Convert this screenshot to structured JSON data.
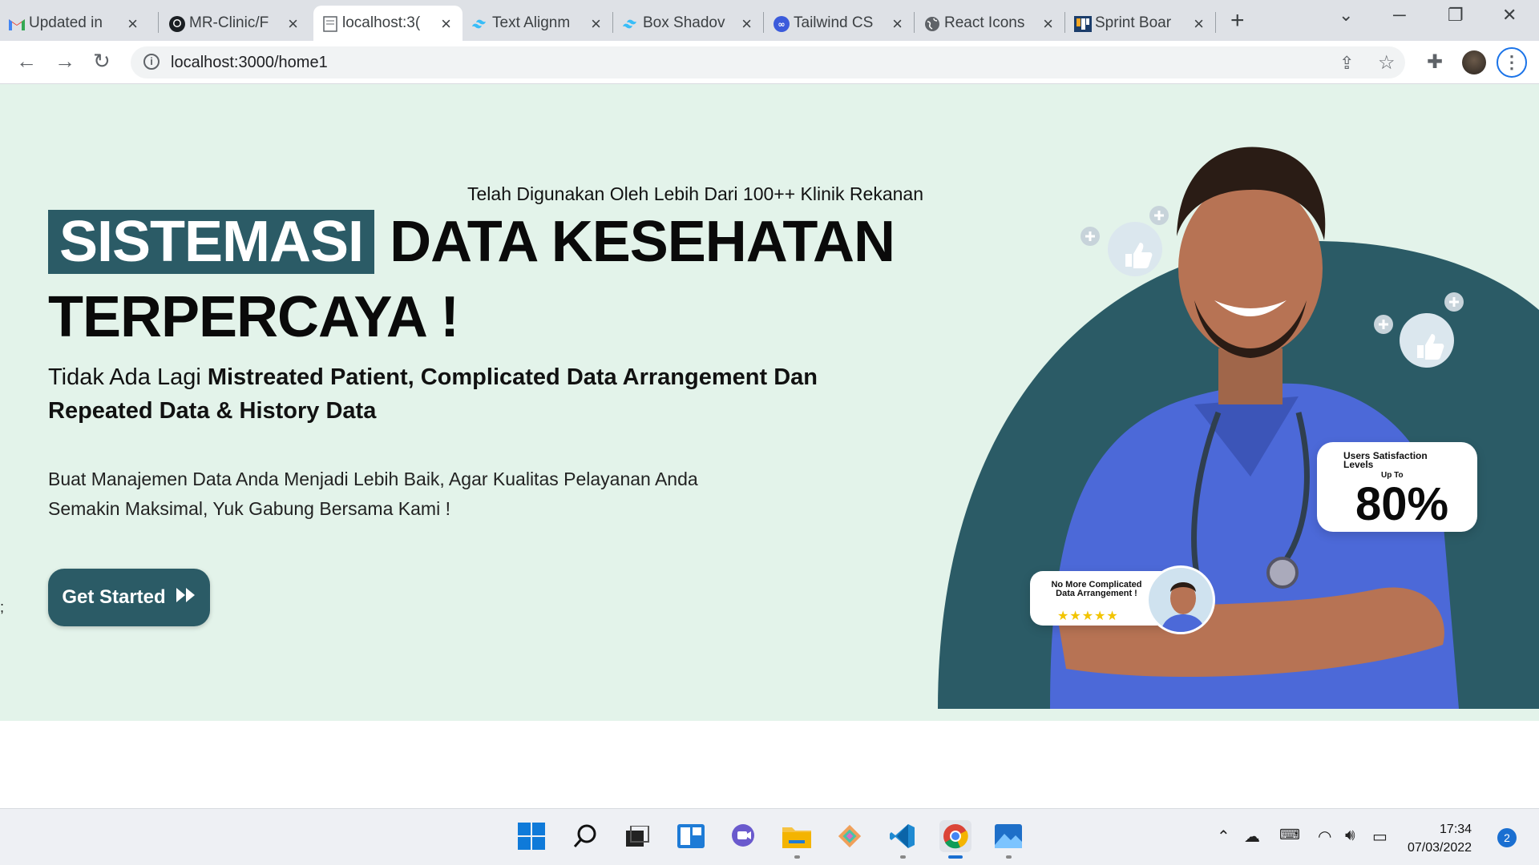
{
  "browser": {
    "tabs": [
      {
        "title": "Updated in",
        "icon": "gmail-icon"
      },
      {
        "title": "MR-Clinic/F",
        "icon": "github-icon"
      },
      {
        "title": "localhost:3(",
        "icon": "page-icon"
      },
      {
        "title": "Text Alignm",
        "icon": "tailwind-icon"
      },
      {
        "title": "Box Shadov",
        "icon": "tailwind-icon"
      },
      {
        "title": "Tailwind CS",
        "icon": "tailwind-cheatsheet-icon"
      },
      {
        "title": "React Icons",
        "icon": "globe-icon"
      },
      {
        "title": "Sprint Boar",
        "icon": "board-icon"
      }
    ],
    "active_tab_index": 2,
    "url": "localhost:3000/home1"
  },
  "hero": {
    "tagline": "Telah Digunakan Oleh Lebih Dari 100++ Klinik Rekanan",
    "heading_highlight": "SISTEMASI",
    "heading_rest_line1": "DATA KESEHATAN",
    "heading_line2": "TERPERCAYA !",
    "sub_prefix": "Tidak Ada Lagi",
    "sub_bold": "Mistreated Patient, Complicated Data Arrangement Dan Repeated Data & History Data",
    "description": "Buat Manajemen Data Anda Menjadi Lebih Baik, Agar Kualitas Pelayanan Anda Semakin Maksimal, Yuk Gabung Bersama Kami !",
    "cta_label": "Get Started",
    "satisfaction_card": {
      "title": "Users Satisfaction Levels",
      "qualifier": "Up To",
      "value": "80%"
    },
    "review_card": {
      "title": "No More Complicated Data Arrangement !",
      "stars": "★★★★★",
      "rating": 5
    },
    "accent_color": "#2b5b66",
    "background_color": "#e3f3ea"
  },
  "below_hero_text": ";",
  "taskbar": {
    "apps": [
      "start-icon",
      "search-icon",
      "task-view-icon",
      "widgets-icon",
      "chat-icon",
      "file-explorer-icon",
      "git-icon",
      "vscode-icon",
      "chrome-icon",
      "photos-icon"
    ],
    "time": "17:34",
    "date": "07/03/2022",
    "notification_count": "2"
  }
}
